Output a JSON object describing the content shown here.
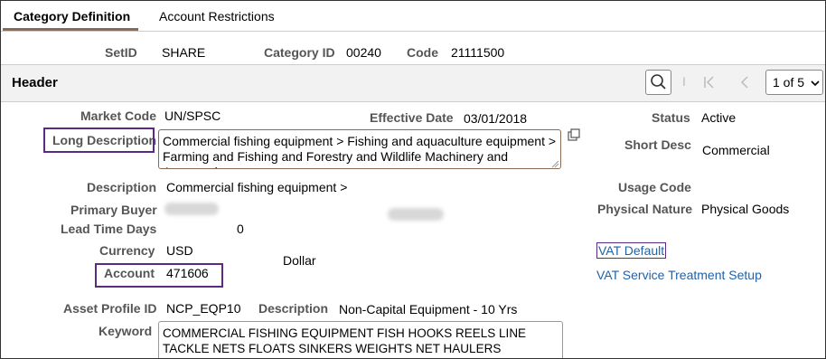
{
  "tabs": [
    {
      "label": "Category Definition",
      "active": true
    },
    {
      "label": "Account Restrictions",
      "active": false
    }
  ],
  "keys": {
    "setid_label": "SetID",
    "setid_value": "SHARE",
    "category_id_label": "Category ID",
    "category_id_value": "00240",
    "code_label": "Code",
    "code_value": "21111500"
  },
  "header": {
    "title": "Header",
    "separator": "I",
    "pager_value": "1 of 5"
  },
  "fields": {
    "market_code_label": "Market Code",
    "market_code_value": "UN/SPSC",
    "effective_date_label": "Effective Date",
    "effective_date_value": "03/01/2018",
    "status_label": "Status",
    "status_value": "Active",
    "long_desc_label": "Long Description",
    "long_desc_value": "Commercial fishing equipment > Fishing and aquaculture equipment > Farming and Fishing and Forestry and Wildlife Machinery and Accessories",
    "short_desc_label": "Short Desc",
    "short_desc_value": "Commercial",
    "description_label": "Description",
    "description_value": "Commercial fishing equipment >",
    "usage_code_label": "Usage Code",
    "primary_buyer_label": "Primary Buyer",
    "physical_nature_label": "Physical Nature",
    "physical_nature_value": "Physical Goods",
    "lead_time_label": "Lead Time Days",
    "lead_time_value": "0",
    "currency_label": "Currency",
    "currency_value": "USD",
    "currency_desc": "Dollar",
    "vat_default_link": "VAT Default",
    "account_label": "Account",
    "account_value": "471606",
    "vat_service_link": "VAT Service Treatment Setup",
    "asset_profile_label": "Asset Profile ID",
    "asset_profile_value": "NCP_EQP10",
    "asset_desc_label": "Description",
    "asset_desc_value": "Non-Capital Equipment - 10 Yrs",
    "keyword_label": "Keyword",
    "keyword_value": "COMMERCIAL FISHING EQUIPMENT FISH HOOKS REELS  LINE TACKLE NETS FLOATS SINKERS WEIGHTS NET HAULERS"
  },
  "colors": {
    "highlight": "#5b2a86",
    "link": "#1f62a8",
    "tab_accent": "#8a6a52"
  },
  "icons": [
    "search-icon",
    "first-page-icon",
    "previous-page-icon",
    "chevron-down-icon",
    "expand-icon",
    "resize-grip-icon"
  ]
}
